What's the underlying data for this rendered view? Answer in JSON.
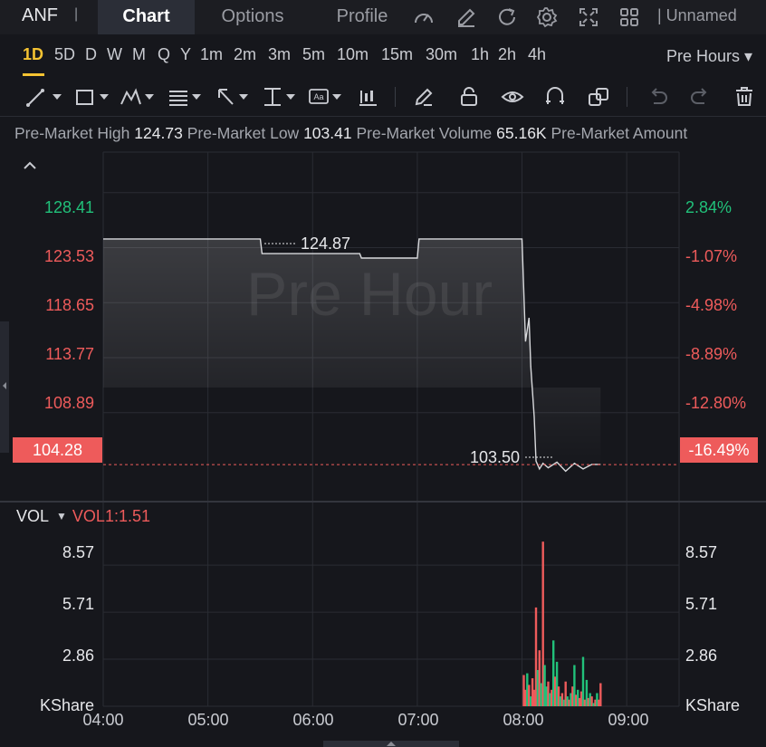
{
  "header": {
    "ticker": "ANF",
    "separator": "|",
    "tabs": [
      {
        "label": "Chart",
        "active": true
      },
      {
        "label": "Options",
        "active": false
      },
      {
        "label": "Profile",
        "active": false
      }
    ],
    "icons": [
      "gauge-icon",
      "edit-icon",
      "refresh-icon",
      "gear-icon",
      "fullscreen-icon",
      "grid-icon"
    ],
    "layout_name": "| Unnamed"
  },
  "intervals": {
    "items": [
      "1D",
      "5D",
      "D",
      "W",
      "M",
      "Q",
      "Y",
      "1m",
      "2m",
      "3m",
      "5m",
      "10m",
      "15m",
      "30m",
      "1h",
      "2h",
      "4h"
    ],
    "active": "1D",
    "session_select": "Pre Hours ▾"
  },
  "stats": [
    {
      "label": "Pre-Market High",
      "value": "124.73"
    },
    {
      "label": "Pre-Market Low",
      "value": "103.41"
    },
    {
      "label": "Pre-Market Volume",
      "value": "65.16K"
    },
    {
      "label": "Pre-Market Amount",
      "value": ""
    }
  ],
  "price_axis": {
    "left": [
      {
        "text": "128.41",
        "color": "green"
      },
      {
        "text": "123.53",
        "color": "red"
      },
      {
        "text": "118.65",
        "color": "red"
      },
      {
        "text": "113.77",
        "color": "red"
      },
      {
        "text": "108.89",
        "color": "red"
      }
    ],
    "right": [
      {
        "text": "2.84%",
        "color": "green"
      },
      {
        "text": "-1.07%",
        "color": "red"
      },
      {
        "text": "-4.98%",
        "color": "red"
      },
      {
        "text": "-8.89%",
        "color": "red"
      },
      {
        "text": "-12.80%",
        "color": "red"
      }
    ],
    "current_price": "104.28",
    "current_pct": "-16.49%"
  },
  "watermark": "Pre Hour",
  "annotations": {
    "high": "124.87",
    "low": "103.50"
  },
  "volume": {
    "indicator": "VOL",
    "caret": "▼",
    "value": "VOL1:1.51",
    "left_labels": [
      "8.57",
      "5.71",
      "2.86",
      "KShare"
    ],
    "right_labels": [
      "8.57",
      "5.71",
      "2.86",
      "KShare"
    ]
  },
  "time_axis": [
    "04:00",
    "05:00",
    "06:00",
    "07:00",
    "08:00",
    "09:00"
  ],
  "colors": {
    "up": "#21c17a",
    "down": "#ee5b5b",
    "active_interval": "#f5c332",
    "background": "#16171c"
  },
  "chart_data": {
    "type": "line",
    "price_line": {
      "x": [
        "04:00",
        "05:30",
        "05:31",
        "06:27",
        "06:28",
        "07:00",
        "07:01",
        "08:00",
        "08:02",
        "08:04",
        "08:05",
        "08:07",
        "08:08",
        "08:10",
        "08:12",
        "08:15",
        "08:20",
        "08:25",
        "08:30",
        "08:35",
        "08:40",
        "08:45"
      ],
      "y": [
        124.3,
        124.3,
        123.0,
        123.0,
        122.6,
        122.6,
        124.3,
        124.3,
        115.2,
        117.3,
        113.0,
        108.5,
        104.6,
        103.9,
        104.4,
        104.0,
        104.5,
        103.7,
        104.4,
        103.9,
        104.3,
        104.3
      ]
    },
    "volume_bars": {
      "unit": "KShare",
      "x": [
        "08:01",
        "08:02",
        "08:03",
        "08:04",
        "08:05",
        "08:06",
        "08:07",
        "08:08",
        "08:09",
        "08:10",
        "08:11",
        "08:12",
        "08:13",
        "08:14",
        "08:15",
        "08:16",
        "08:17",
        "08:18",
        "08:19",
        "08:20",
        "08:21",
        "08:22",
        "08:23",
        "08:24",
        "08:25",
        "08:26",
        "08:27",
        "08:28",
        "08:29",
        "08:30",
        "08:31",
        "08:32",
        "08:33",
        "08:34",
        "08:35",
        "08:36",
        "08:37",
        "08:38",
        "08:39",
        "08:40",
        "08:41",
        "08:42",
        "08:43",
        "08:44",
        "08:45"
      ],
      "values": [
        1.9,
        1.0,
        2.0,
        1.3,
        0.6,
        1.7,
        1.0,
        6.0,
        2.2,
        3.4,
        1.4,
        10.0,
        2.5,
        1.2,
        1.5,
        0.8,
        1.0,
        4.0,
        1.8,
        2.7,
        1.2,
        0.6,
        0.8,
        0.4,
        1.5,
        0.6,
        0.4,
        0.8,
        1.2,
        2.5,
        0.7,
        1.0,
        0.5,
        0.9,
        3.0,
        0.4,
        1.6,
        0.5,
        0.8,
        0.6,
        0.2,
        0.4,
        0.8,
        0.4,
        1.4
      ],
      "colors": [
        "down",
        "down",
        "up",
        "down",
        "up",
        "down",
        "down",
        "down",
        "up",
        "down",
        "up",
        "down",
        "up",
        "up",
        "down",
        "up",
        "down",
        "up",
        "down",
        "up",
        "down",
        "up",
        "down",
        "up",
        "down",
        "up",
        "down",
        "up",
        "down",
        "up",
        "down",
        "up",
        "down",
        "down",
        "up",
        "down",
        "up",
        "down",
        "up",
        "down",
        "up",
        "down",
        "up",
        "down",
        "down"
      ]
    },
    "x_range": [
      "04:00",
      "09:30"
    ],
    "price_range": [
      101.0,
      132.0
    ],
    "volume_range": [
      0,
      11.0
    ],
    "grid": true
  }
}
